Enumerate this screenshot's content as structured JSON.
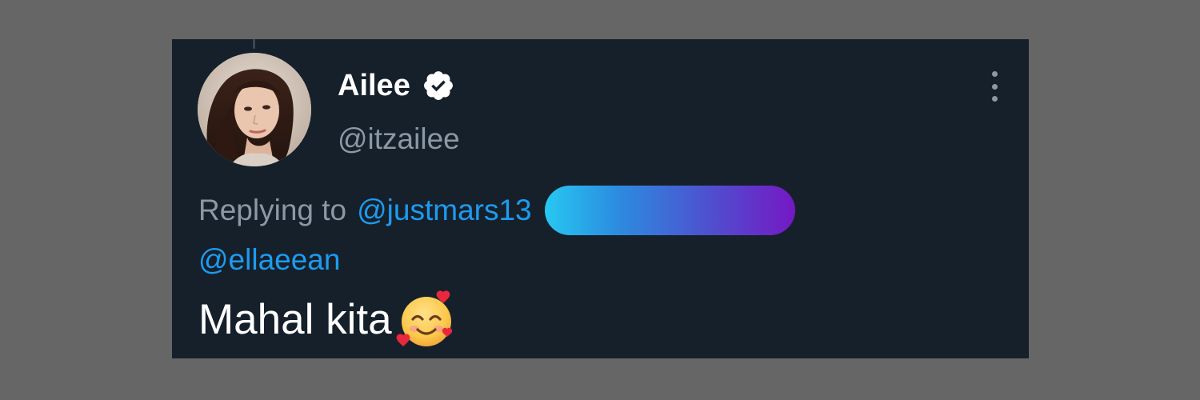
{
  "tweet": {
    "author": {
      "display_name": "Ailee",
      "handle": "@itzailee",
      "verified": true,
      "avatar_icon": "avatar-photo"
    },
    "more_icon": "more-vertical-icon",
    "reply": {
      "prefix": "Replying to",
      "mentions": [
        "@justmars13",
        "@ellaeean"
      ],
      "redacted_mention": {
        "gradient_colors": [
          "#27c8f2",
          "#2b8ee0",
          "#4b56d0",
          "#7418c4"
        ]
      }
    },
    "text": "Mahal kita",
    "emoji": "smiling-face-with-hearts-emoji"
  },
  "colors": {
    "background": "#666666",
    "card": "#16202b",
    "primary_text": "#ffffff",
    "secondary_text": "#8b98a5",
    "link": "#1d9bf0"
  }
}
